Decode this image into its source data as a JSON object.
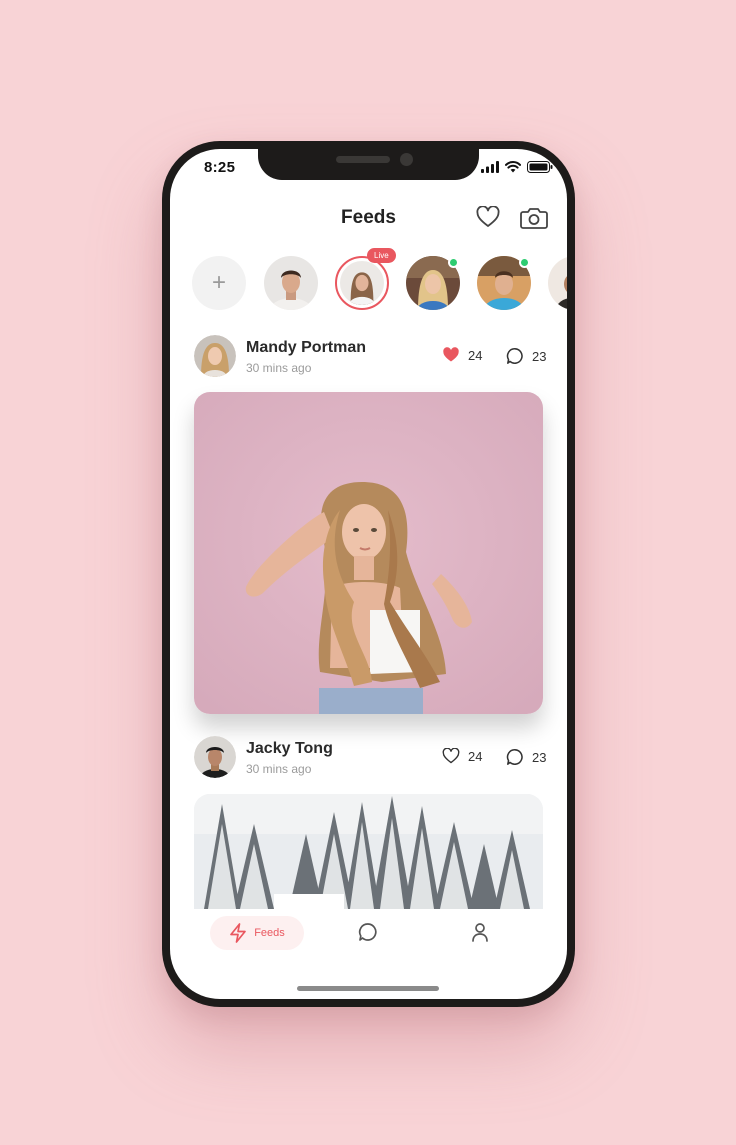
{
  "status_bar": {
    "time": "8:25"
  },
  "header": {
    "title": "Feeds"
  },
  "stories": {
    "add_label": "+",
    "live_badge": "Live"
  },
  "posts": [
    {
      "name": "Mandy Portman",
      "time": "30 mins ago",
      "likes": "24",
      "comments": "23",
      "liked": true
    },
    {
      "name": "Jacky Tong",
      "time": "30 mins ago",
      "likes": "24",
      "comments": "23",
      "liked": false
    }
  ],
  "nav": {
    "feeds_label": "Feeds"
  },
  "colors": {
    "accent": "#e9575f",
    "online": "#2ecc71",
    "background": "#f8d3d6"
  },
  "icons": [
    "heart-icon",
    "camera-icon",
    "plus-icon",
    "comment-icon",
    "lightning-icon",
    "chat-icon",
    "user-icon",
    "signal-icon",
    "wifi-icon",
    "battery-icon"
  ]
}
